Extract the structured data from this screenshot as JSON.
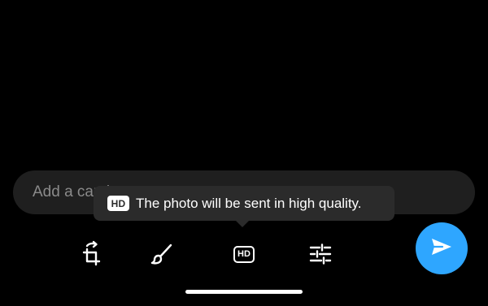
{
  "colors": {
    "background": "#000000",
    "caption_bg": "#1f1f1f",
    "tooltip_bg": "#2b2b2b",
    "accent": "#2ea6ff",
    "icon": "#ffffff"
  },
  "caption": {
    "placeholder": "Add a caption..."
  },
  "tooltip": {
    "badge": "HD",
    "text": "The photo will be sent in high quality."
  },
  "toolbar": {
    "crop_icon": "crop-rotate-icon",
    "draw_icon": "brush-icon",
    "hd_icon": "hd-icon",
    "hd_label": "HD",
    "adjust_icon": "sliders-icon"
  },
  "send": {
    "icon": "send-icon"
  }
}
